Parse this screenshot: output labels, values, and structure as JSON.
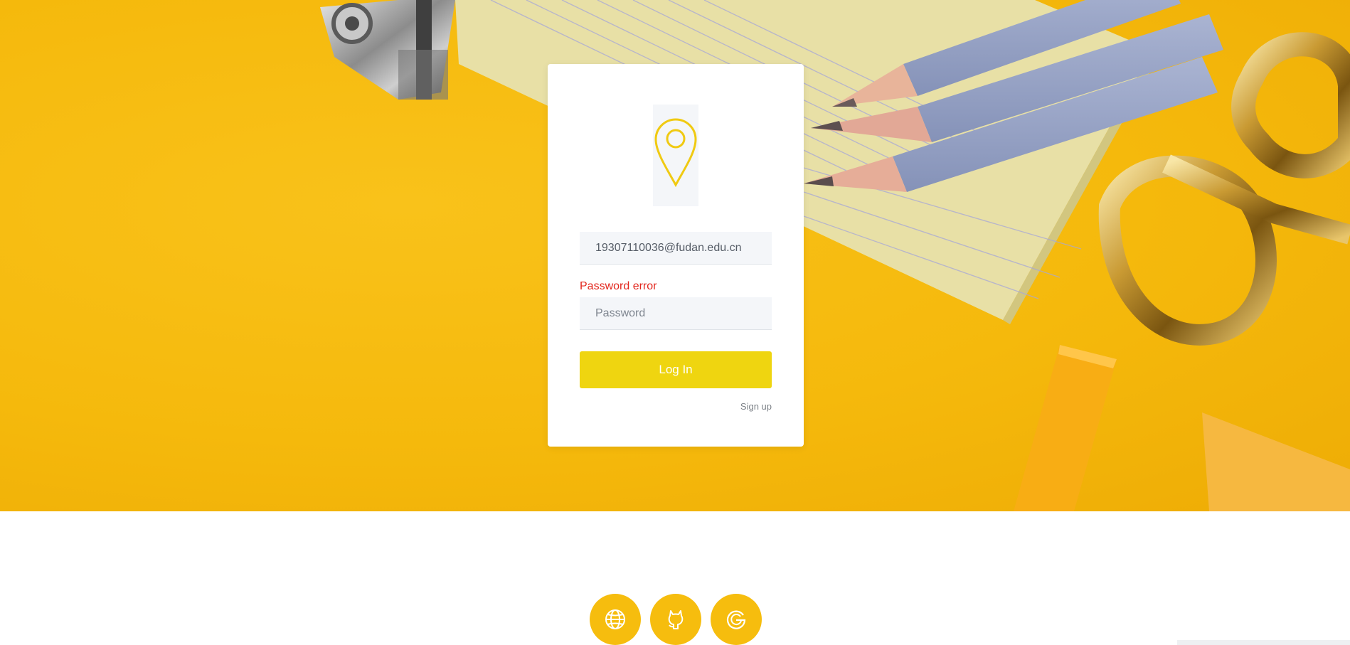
{
  "login": {
    "email_value": "19307110036@fudan.edu.cn",
    "error_message": "Password error",
    "password_placeholder": "Password",
    "login_label": "Log In",
    "signup_label": "Sign up"
  },
  "icons": {
    "logo": "map-pin-icon",
    "social": [
      "globe-icon",
      "github-icon",
      "google-icon"
    ]
  },
  "colors": {
    "accent_yellow": "#f6bd0e",
    "button_yellow": "#efd510",
    "error_red": "#e2271e",
    "input_bg": "#f4f6f9"
  }
}
